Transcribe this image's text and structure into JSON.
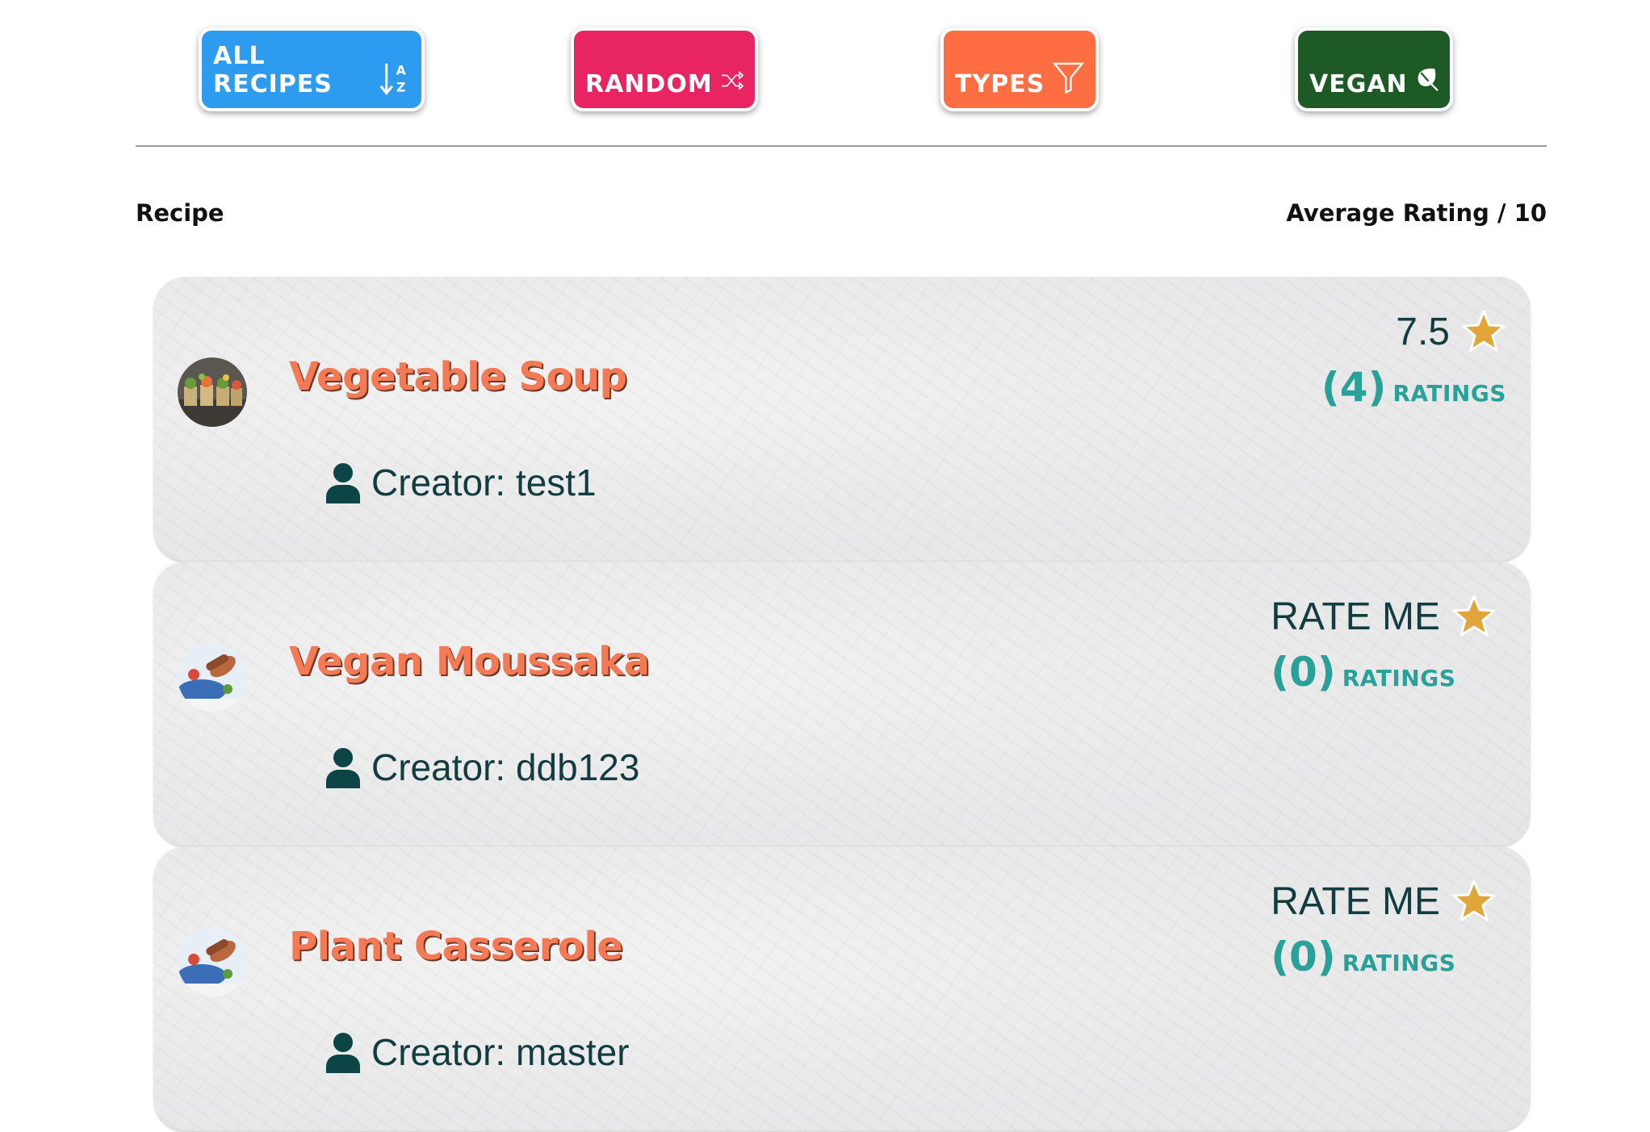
{
  "nav": {
    "buttons": [
      {
        "label": "ALL RECIPES",
        "icon": "sort-alpha-down-icon",
        "color": "#2d9cf0"
      },
      {
        "label": "RANDOM",
        "icon": "shuffle-icon",
        "color": "#e82463"
      },
      {
        "label": "TYPES",
        "icon": "filter-icon",
        "color": "#ff6d42"
      },
      {
        "label": "VEGAN",
        "icon": "leaf-icon",
        "color": "#1e5a25"
      }
    ],
    "sort_icon_letters": {
      "top": "A",
      "bottom": "Z"
    }
  },
  "table": {
    "recipe_header": "Recipe",
    "rating_header": "Average Rating / 10"
  },
  "recipes": [
    {
      "title": "Vegetable Soup",
      "creator": "Creator: test1",
      "rating": "7.5",
      "count": "(4)",
      "count_label": "RATINGS",
      "thumb": "vegetable-soup-photo"
    },
    {
      "title": "Vegan Moussaka",
      "creator": "Creator: ddb123",
      "rating": "RATE ME",
      "count": "(0)",
      "count_label": "RATINGS",
      "thumb": "cooking-photo"
    },
    {
      "title": "Plant Casserole",
      "creator": "Creator: master",
      "rating": "RATE ME",
      "count": "(0)",
      "count_label": "RATINGS",
      "thumb": "cooking-photo"
    }
  ],
  "colors": {
    "title": "#f37a55",
    "creator": "#123c3f",
    "rating_count": "#2aa198",
    "star": "#e0a63a"
  }
}
